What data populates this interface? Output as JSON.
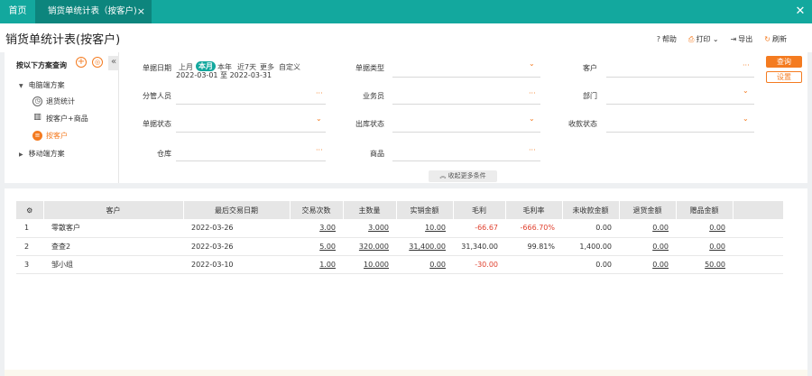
{
  "tabs": {
    "home": "首页",
    "active": "销货单统计表（按客户)",
    "close": "×"
  },
  "window_close": "✕",
  "page_title": "销货单统计表(按客户)",
  "toolbar": {
    "help": "帮助",
    "print": "打印",
    "export": "导出",
    "refresh": "刷新"
  },
  "left_panel": {
    "heading": "按以下方案查询",
    "tree": [
      {
        "label": "电脑端方案",
        "level": 0,
        "expanded": true
      },
      {
        "label": "退货统计",
        "level": 1
      },
      {
        "label": "按客户+商品",
        "level": 1
      },
      {
        "label": "按客户",
        "level": 1,
        "selected": true
      },
      {
        "label": "移动端方案",
        "level": 0,
        "expanded": false
      }
    ]
  },
  "filters": {
    "date_label": "单据日期",
    "date_options": [
      "上月",
      "本月",
      "本年",
      "近7天",
      "更多",
      "自定义"
    ],
    "date_selected": "本月",
    "date_range": "2022-03-01 至 2022-03-31",
    "doc_type": "单据类型",
    "customer": "客户",
    "manager": "分管人员",
    "salesman": "业务员",
    "department": "部门",
    "doc_status": "单据状态",
    "outbound_status": "出库状态",
    "receipt_status": "收款状态",
    "warehouse": "仓库",
    "product": "商品",
    "more_conditions": "收起更多条件"
  },
  "buttons": {
    "query": "查询",
    "settings": "设置"
  },
  "table": {
    "columns": [
      "客户",
      "最后交易日期",
      "交易次数",
      "主数量",
      "实销金额",
      "毛利",
      "毛利率",
      "未收款金额",
      "退货金额",
      "赠品金额"
    ],
    "rows": [
      {
        "idx": "1",
        "customer": "零散客户",
        "last_date": "2022-03-26",
        "count": "3.00",
        "qty": "3.000",
        "amount": "10.00",
        "profit": "-66.67",
        "margin": "-666.70%",
        "unpaid": "0.00",
        "returns": "0.00",
        "gift": "0.00"
      },
      {
        "idx": "2",
        "customer": "查查2",
        "last_date": "2022-03-26",
        "count": "5.00",
        "qty": "320.000",
        "amount": "31,400.00",
        "profit": "31,340.00",
        "margin": "99.81%",
        "unpaid": "1,400.00",
        "returns": "0.00",
        "gift": "0.00"
      },
      {
        "idx": "3",
        "customer": "邹小组",
        "last_date": "2022-03-10",
        "count": "1.00",
        "qty": "10.000",
        "amount": "0.00",
        "profit": "-30.00",
        "margin": "",
        "unpaid": "0.00",
        "returns": "0.00",
        "gift": "50.00"
      }
    ]
  },
  "colors": {
    "teal": "#13a89e",
    "teal_dark": "#0d857d",
    "orange": "#f47b20",
    "negative": "#e0412f"
  }
}
